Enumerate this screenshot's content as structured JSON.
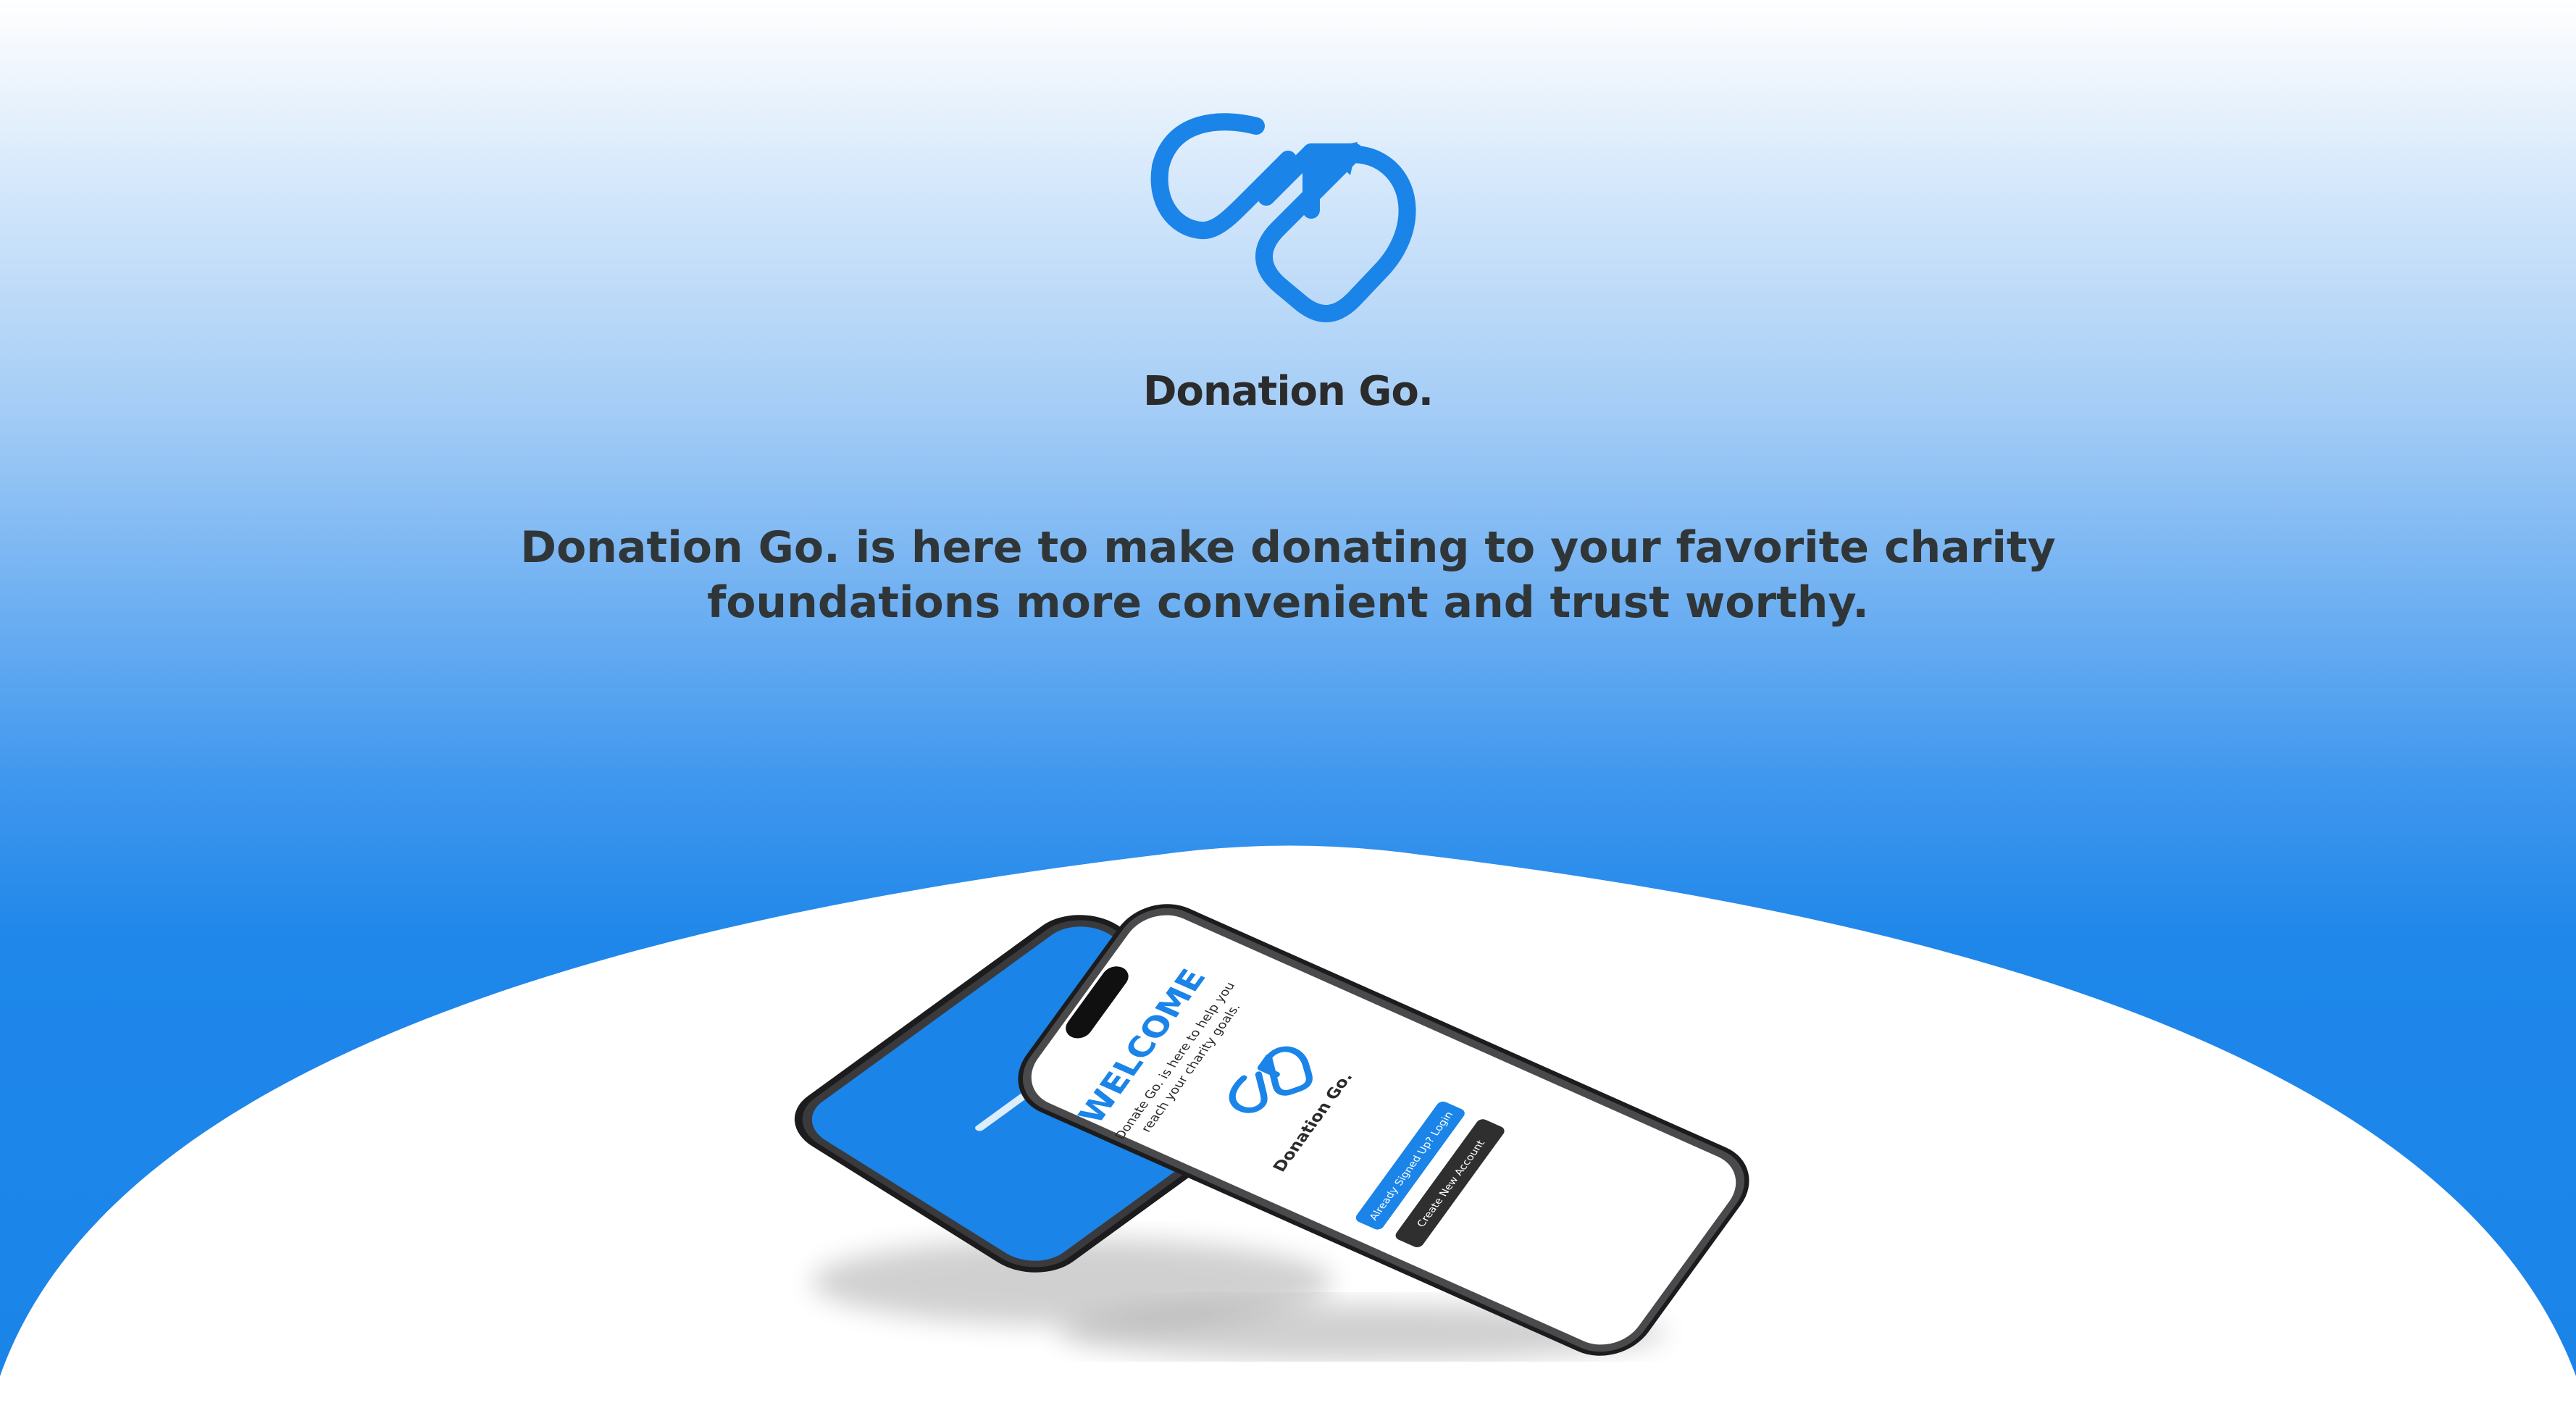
{
  "brand": {
    "name": "Donation Go."
  },
  "tagline": {
    "line1": "Donation Go. is here to make donating to your favorite charity",
    "line2": "foundations more convenient and trust worthy."
  },
  "colors": {
    "accent": "#1a84e9",
    "dark_text": "#2b2b2b",
    "tagline_text": "#303638",
    "phone_body": "#1c1c1e",
    "button_dark": "#2f2f2f"
  },
  "icons": {
    "logo": "heart-arrow-logo-icon"
  },
  "phone_front": {
    "welcome": "WELCOME",
    "intro_line1": "Donate Go. is here to help you",
    "intro_line2": "reach your charity goals.",
    "brand": "Donation Go.",
    "login_button": "Already Signed Up? Login",
    "create_button": "Create New Account"
  }
}
